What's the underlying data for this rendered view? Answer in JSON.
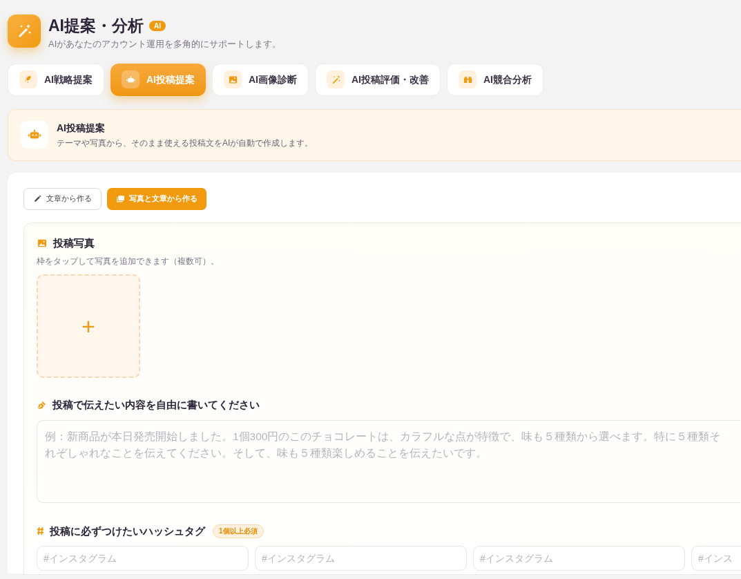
{
  "header": {
    "title": "AI提案・分析",
    "badge": "AI",
    "subtitle": "AIがあなたのアカウント運用を多角的にサポートします。"
  },
  "tabs": [
    {
      "label": "AI戦略提案",
      "selected": false
    },
    {
      "label": "AI投稿提案",
      "selected": true
    },
    {
      "label": "AI画像診断",
      "selected": false
    },
    {
      "label": "AI投稿評価・改善",
      "selected": false
    },
    {
      "label": "AI競合分析",
      "selected": false
    }
  ],
  "banner": {
    "title": "AI投稿提案",
    "description": "テーマや写真から、そのまま使える投稿文をAIが自動で作成します。"
  },
  "modes": [
    {
      "label": "文章から作る",
      "selected": false
    },
    {
      "label": "写真と文章から作る",
      "selected": true
    }
  ],
  "photo_section": {
    "title": "投稿写真",
    "hint": "枠をタップして写真を追加できます（複数可）。",
    "add_label": "+"
  },
  "content_section": {
    "title": "投稿で伝えたい内容を自由に書いてください",
    "placeholder": "例：新商品が本日発売開始しました。1個300円のこのチョコレートは、カラフルな点が特徴で、味も５種類から選べます。特に５種類それぞしゃれなことを伝えてください。そして、味も５種類楽しめることを伝えたいです。"
  },
  "hashtag_section": {
    "title": "投稿に必ずつけたいハッシュタグ",
    "badge": "1個以上必須",
    "fields": [
      {
        "placeholder": "#インスタグラム"
      },
      {
        "placeholder": "#インスタグラム"
      },
      {
        "placeholder": "#インスタグラム"
      },
      {
        "placeholder": "#インス"
      }
    ]
  }
}
